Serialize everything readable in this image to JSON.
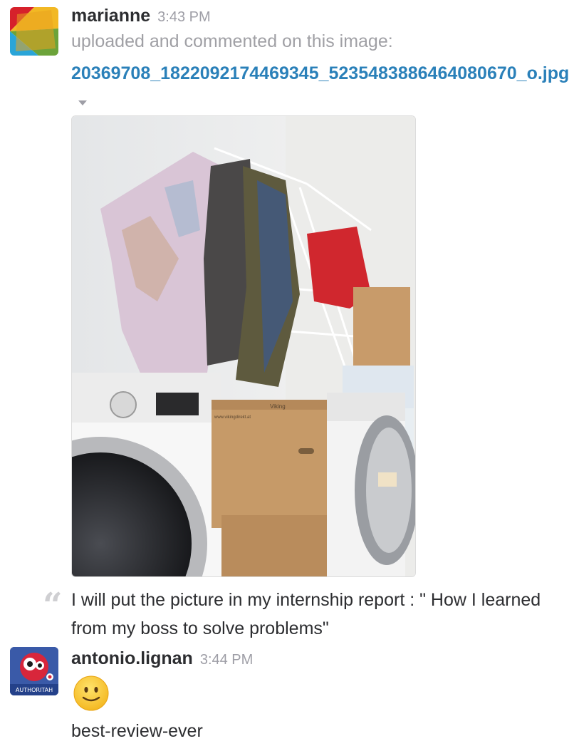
{
  "messages": [
    {
      "user": "marianne",
      "time": "3:43 PM",
      "action": "uploaded and commented on this image:",
      "file_name": "20369708_1822092174469345_5235483886464080670_o.jpg",
      "comment": "I will put the picture in my internship report : \" How I learned from my boss to solve problems\""
    },
    {
      "user": "antonio.lignan",
      "time": "3:44 PM",
      "avatar_text": "AUTHORITAH",
      "emoji": "slightly-smiling-face",
      "text": "best-review-ever"
    }
  ],
  "photo": {
    "box_labels": [
      "Viking",
      "www.vikingdirekt.at"
    ]
  },
  "colors": {
    "link": "#2a80b9",
    "muted": "#9e9ea6",
    "text": "#2c2d30"
  }
}
